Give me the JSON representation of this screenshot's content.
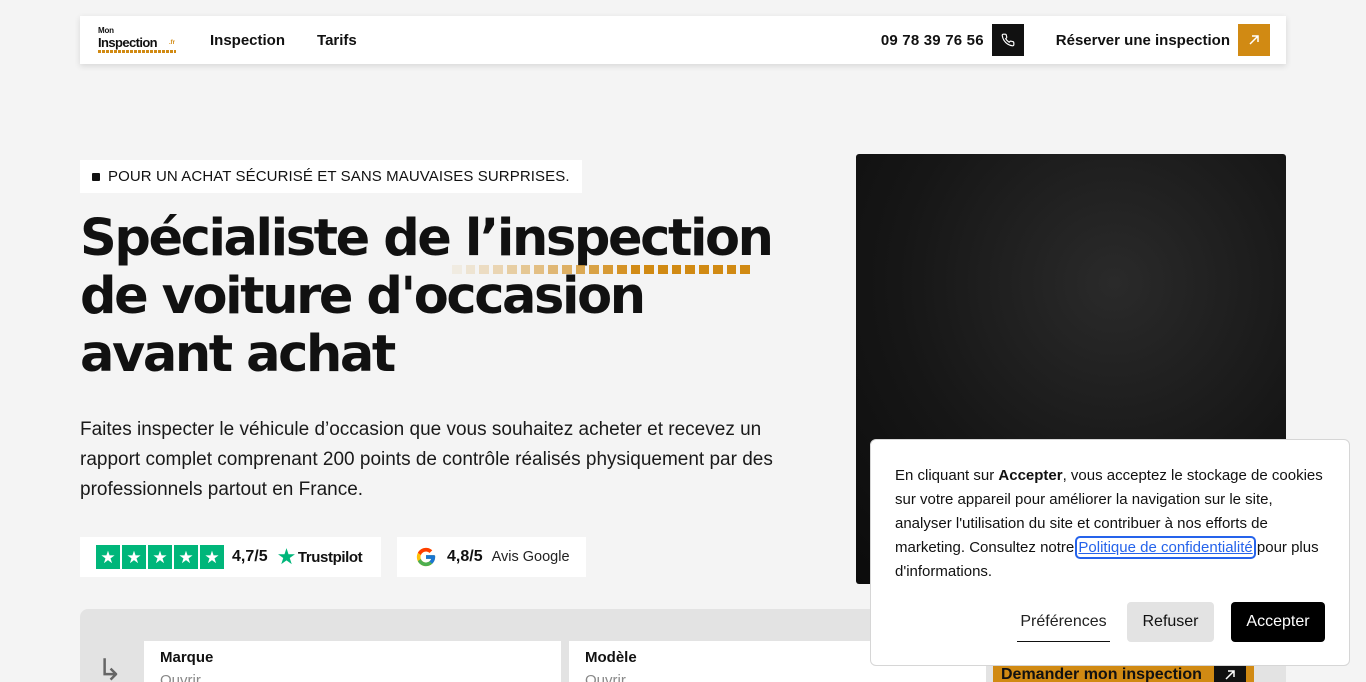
{
  "nav": {
    "logo_small": "Mon",
    "logo_main": "Inspection",
    "logo_tld": ".fr",
    "links": [
      "Inspection",
      "Tarifs"
    ],
    "phone": "09 78 39 76 56",
    "reserve": "Réserver une inspection",
    "phone_icon": "phone-icon",
    "reserve_icon": "arrow-up-right-icon"
  },
  "hero": {
    "kicker": "POUR UN ACHAT SÉCURISÉ ET SANS MAUVAISES SURPRISES.",
    "title_lines": [
      "Spécialiste de l’inspection",
      "de voiture d'occasion",
      "avant achat"
    ],
    "lead": "Faites inspecter le véhicule d’occasion que vous souhaitez acheter et recevez un rapport complet comprenant 200 points de contrôle réalisés physiquement par des professionnels partout en France.",
    "trustpilot": {
      "score": "4,7/5",
      "brand": "Trustpilot",
      "stars": 5,
      "color": "#00b67a"
    },
    "google": {
      "score": "4,8/5",
      "label": "Avis Google"
    }
  },
  "form": {
    "brand_label": "Marque",
    "brand_placeholder": "Ouvrir",
    "model_label": "Modèle",
    "model_placeholder": "Ouvrir",
    "cta": "Demander mon inspection"
  },
  "cookie": {
    "t1": "En cliquant sur ",
    "t_bold": "Accepter",
    "t2": ", vous acceptez le stockage de cookies sur votre appareil pour améliorer la navigation sur le site, analyser l'utilisation du site et contribuer à nos efforts de marketing. Consultez notre ",
    "link": "Politique de confidentialité",
    "t3": " pour plus d'informations.",
    "preferences": "Préférences",
    "refuse": "Refuser",
    "accept": "Accepter"
  },
  "colors": {
    "accent": "#d18a13",
    "dark": "#111111",
    "trustpilot": "#00b67a"
  }
}
